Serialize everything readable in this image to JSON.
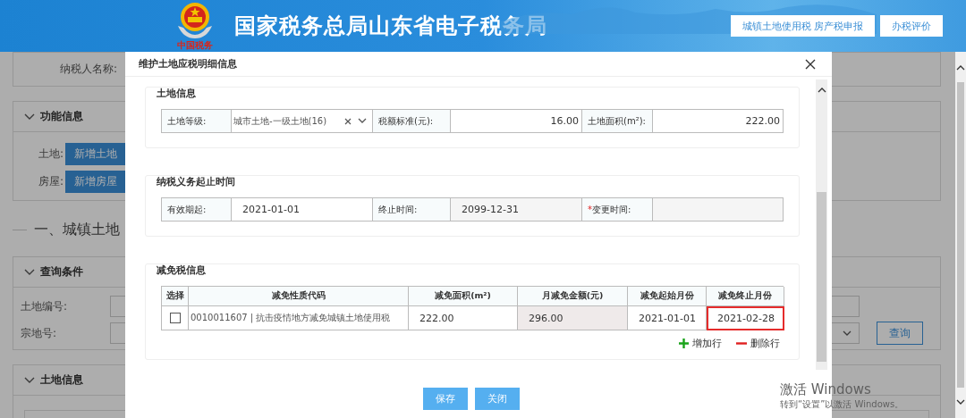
{
  "header": {
    "logo_text": "中国税务",
    "title": "国家税务总局山东省电子税务局",
    "buttons": [
      "城镇土地使用税 房产税申报",
      "办税评价"
    ]
  },
  "background": {
    "taxpayer_label": "纳税人名称:",
    "function_panel": {
      "title": "功能信息",
      "expanded": true,
      "rows": [
        {
          "label": "土地:",
          "button": "新增土地"
        },
        {
          "label": "房屋:",
          "button": "新增房屋"
        }
      ]
    },
    "section_heading": "一、城镇土地",
    "query_panel": {
      "title": "查询条件",
      "expanded": true,
      "fields": [
        {
          "label": "土地编号:"
        },
        {
          "label": "宗地号:"
        }
      ],
      "query_button": "查询"
    },
    "land_panel": {
      "title": "土地信息",
      "expanded": true
    }
  },
  "dialog": {
    "title": "维护土地应税明细信息",
    "land_info": {
      "title": "土地信息",
      "grade_label": "土地等级:",
      "grade_value": "城市土地-一级土地(16)",
      "rate_label": "税额标准(元):",
      "rate_value": "16.00",
      "area_label": "土地面积(m²):",
      "area_value": "222.00"
    },
    "period": {
      "title": "纳税义务起止时间",
      "start_label": "有效期起:",
      "start_value": "2021-01-01",
      "end_label": "终止时间:",
      "end_value": "2099-12-31",
      "change_required_mark": "*",
      "change_label": "变更时间:"
    },
    "relief": {
      "title": "减免税信息",
      "columns": [
        "选择",
        "减免性质代码",
        "减免面积(m²)",
        "月减免金额(元)",
        "减免起始月份",
        "减免终止月份"
      ],
      "rows": [
        {
          "checked": false,
          "code": "0010011607 | 抗击疫情地方减免城镇土地使用税",
          "area": "222.00",
          "monthly_amount": "296.00",
          "start_month": "2021-01-01",
          "end_month": "2021-02-28",
          "end_month_highlighted": true
        }
      ],
      "add_row": "增加行",
      "delete_row": "删除行"
    },
    "buttons": [
      "保存",
      "关闭"
    ]
  },
  "windows_activation": {
    "title": "激活 Windows",
    "subtitle": "转到“设置”以激活 Windows。"
  }
}
